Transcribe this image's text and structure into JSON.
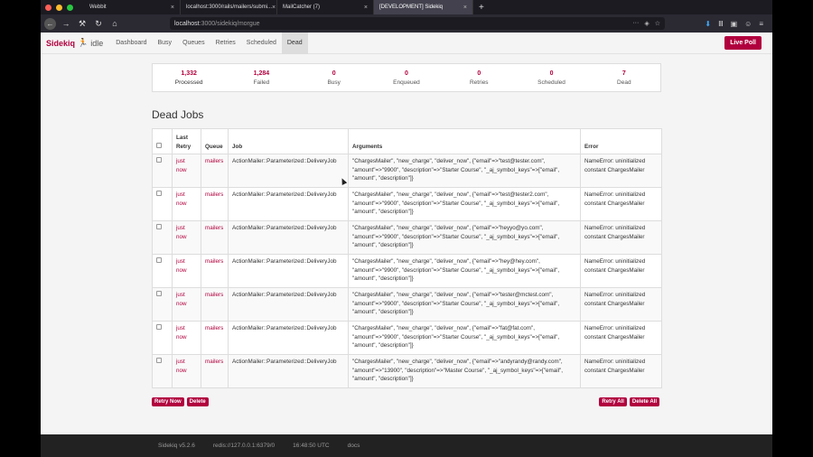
{
  "browser": {
    "tabs": [
      {
        "title": "Webbit",
        "active": false
      },
      {
        "title": "localhost:3000/rails/mailers/submi...",
        "active": false
      },
      {
        "title": "MailCatcher (7)",
        "active": false
      },
      {
        "title": "[DEVELOPMENT] Sidekiq",
        "active": true
      }
    ],
    "url_host": "localhost",
    "url_path": ":3000/sidekiq/morgue"
  },
  "app": {
    "brand": "Sidekiq",
    "status": "idle",
    "nav": [
      "Dashboard",
      "Busy",
      "Queues",
      "Retries",
      "Scheduled",
      "Dead"
    ],
    "active_nav": "Dead",
    "live_poll": "Live Poll"
  },
  "stats": [
    {
      "value": "1,332",
      "label": "Processed"
    },
    {
      "value": "1,284",
      "label": "Failed"
    },
    {
      "value": "0",
      "label": "Busy"
    },
    {
      "value": "0",
      "label": "Enqueued"
    },
    {
      "value": "0",
      "label": "Retries"
    },
    {
      "value": "0",
      "label": "Scheduled"
    },
    {
      "value": "7",
      "label": "Dead"
    }
  ],
  "page_title": "Dead Jobs",
  "table": {
    "headers": [
      "Last Retry",
      "Queue",
      "Job",
      "Arguments",
      "Error"
    ],
    "rows": [
      {
        "retry": "just now",
        "queue": "mailers",
        "job": "ActionMailer::Parameterized::DeliveryJob",
        "args": "\"ChargesMailer\", \"new_charge\", \"deliver_now\", {\"email\"=>\"test@tester.com\", \"amount\"=>\"9900\", \"description\"=>\"Starter Course\", \"_aj_symbol_keys\"=>[\"email\", \"amount\", \"description\"]}",
        "error": "NameError: uninitialized constant ChargesMailer"
      },
      {
        "retry": "just now",
        "queue": "mailers",
        "job": "ActionMailer::Parameterized::DeliveryJob",
        "args": "\"ChargesMailer\", \"new_charge\", \"deliver_now\", {\"email\"=>\"test@tester2.com\", \"amount\"=>\"9900\", \"description\"=>\"Starter Course\", \"_aj_symbol_keys\"=>[\"email\", \"amount\", \"description\"]}",
        "error": "NameError: uninitialized constant ChargesMailer"
      },
      {
        "retry": "just now",
        "queue": "mailers",
        "job": "ActionMailer::Parameterized::DeliveryJob",
        "args": "\"ChargesMailer\", \"new_charge\", \"deliver_now\", {\"email\"=>\"heyyo@yo.com\", \"amount\"=>\"9900\", \"description\"=>\"Starter Course\", \"_aj_symbol_keys\"=>[\"email\", \"amount\", \"description\"]}",
        "error": "NameError: uninitialized constant ChargesMailer"
      },
      {
        "retry": "just now",
        "queue": "mailers",
        "job": "ActionMailer::Parameterized::DeliveryJob",
        "args": "\"ChargesMailer\", \"new_charge\", \"deliver_now\", {\"email\"=>\"hey@hey.com\", \"amount\"=>\"9900\", \"description\"=>\"Starter Course\", \"_aj_symbol_keys\"=>[\"email\", \"amount\", \"description\"]}",
        "error": "NameError: uninitialized constant ChargesMailer"
      },
      {
        "retry": "just now",
        "queue": "mailers",
        "job": "ActionMailer::Parameterized::DeliveryJob",
        "args": "\"ChargesMailer\", \"new_charge\", \"deliver_now\", {\"email\"=>\"tester@mctest.com\", \"amount\"=>\"9900\", \"description\"=>\"Starter Course\", \"_aj_symbol_keys\"=>[\"email\", \"amount\", \"description\"]}",
        "error": "NameError: uninitialized constant ChargesMailer"
      },
      {
        "retry": "just now",
        "queue": "mailers",
        "job": "ActionMailer::Parameterized::DeliveryJob",
        "args": "\"ChargesMailer\", \"new_charge\", \"deliver_now\", {\"email\"=>\"fat@fat.com\", \"amount\"=>\"9900\", \"description\"=>\"Starter Course\", \"_aj_symbol_keys\"=>[\"email\", \"amount\", \"description\"]}",
        "error": "NameError: uninitialized constant ChargesMailer"
      },
      {
        "retry": "just now",
        "queue": "mailers",
        "job": "ActionMailer::Parameterized::DeliveryJob",
        "args": "\"ChargesMailer\", \"new_charge\", \"deliver_now\", {\"email\"=>\"andyrandy@randy.com\", \"amount\"=>\"13900\", \"description\"=>\"Master Course\", \"_aj_symbol_keys\"=>[\"email\", \"amount\", \"description\"]}",
        "error": "NameError: uninitialized constant ChargesMailer"
      }
    ]
  },
  "actions": {
    "retry_now": "Retry Now",
    "delete": "Delete",
    "retry_all": "Retry All",
    "delete_all": "Delete All"
  },
  "footer": {
    "version": "Sidekiq v5.2.6",
    "redis": "redis://127.0.0.1:6379/0",
    "time": "16:48:50 UTC",
    "docs": "docs"
  },
  "colors": {
    "brand": "#b1003e",
    "footer": "#222222"
  }
}
